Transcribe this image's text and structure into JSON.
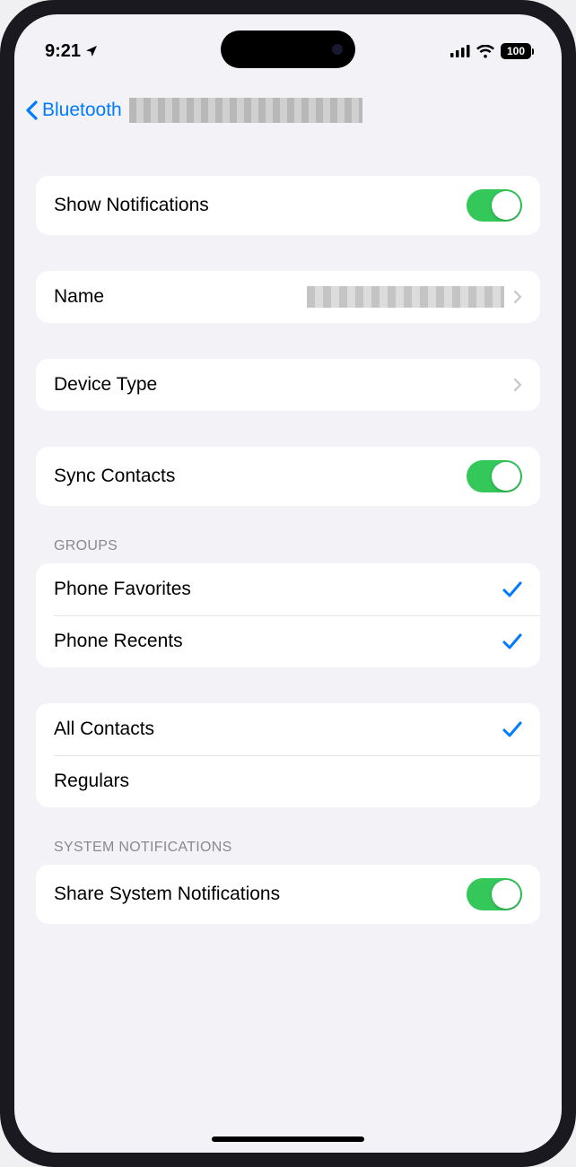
{
  "status": {
    "time": "9:21",
    "battery": "100"
  },
  "nav": {
    "back_label": "Bluetooth"
  },
  "rows": {
    "show_notifications": "Show Notifications",
    "name": "Name",
    "device_type": "Device Type",
    "sync_contacts": "Sync Contacts",
    "phone_favorites": "Phone Favorites",
    "phone_recents": "Phone Recents",
    "all_contacts": "All Contacts",
    "regulars": "Regulars",
    "share_system_notifications": "Share System Notifications"
  },
  "headers": {
    "groups": "GROUPS",
    "system_notifications": "SYSTEM NOTIFICATIONS"
  },
  "toggles": {
    "show_notifications": true,
    "sync_contacts": true,
    "share_system_notifications": true
  },
  "checks": {
    "phone_favorites": true,
    "phone_recents": true,
    "all_contacts": true,
    "regulars": false
  },
  "colors": {
    "accent_blue": "#007aff",
    "toggle_green": "#34c759",
    "bg": "#f2f2f7"
  }
}
